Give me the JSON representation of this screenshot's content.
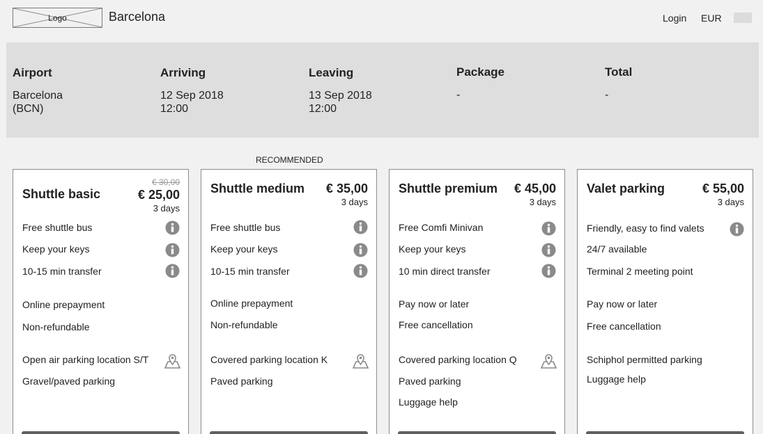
{
  "header": {
    "logo_text": "Logo",
    "city": "Barcelona",
    "login": "Login",
    "currency": "EUR"
  },
  "summary": {
    "airport_label": "Airport",
    "airport_value": "Barcelona\n(BCN)",
    "arriving_label": "Arriving",
    "arriving_value": "12 Sep 2018\n12:00",
    "leaving_label": "Leaving",
    "leaving_value": "13 Sep 2018\n12:00",
    "package_label": "Package",
    "package_value": "-",
    "total_label": "Total",
    "total_value": "-"
  },
  "recommended_label": "RECOMMENDED",
  "cards": [
    {
      "title": "Shuttle basic",
      "old_price": "€ 30,00",
      "price": "€ 25,00",
      "days": "3 days",
      "features": [
        "Free shuttle bus",
        "Keep your keys",
        "10-15 min transfer"
      ],
      "payment": [
        "Online prepayment",
        "Non-refundable"
      ],
      "parking": [
        "Open air parking location S/T",
        "Gravel/paved parking"
      ]
    },
    {
      "title": "Shuttle medium",
      "price": "€ 35,00",
      "days": "3 days",
      "features": [
        "Free shuttle bus",
        "Keep your keys",
        "10-15 min transfer"
      ],
      "payment": [
        "Online prepayment",
        "Non-refundable"
      ],
      "parking": [
        "Covered parking location K",
        "Paved parking"
      ]
    },
    {
      "title": "Shuttle premium",
      "price": "€ 45,00",
      "days": "3 days",
      "features": [
        "Free Comfi Minivan",
        "Keep your keys",
        "10 min direct transfer"
      ],
      "payment": [
        "Pay now or later",
        "Free cancellation"
      ],
      "parking": [
        "Covered parking location Q",
        "Paved parking",
        "Luggage help"
      ]
    },
    {
      "title": "Valet parking",
      "price": "€ 55,00",
      "days": "3 days",
      "features": [
        "Friendly, easy to find valets",
        "24/7 available",
        "Terminal 2 meeting point"
      ],
      "payment": [
        "Pay now or later",
        "Free cancellation"
      ],
      "parking": [
        "Schiphol permitted parking",
        "Luggage help"
      ]
    }
  ],
  "icons": {
    "info": "info-icon",
    "map": "map-pin-icon"
  },
  "colors": {
    "background": "#f1f1f1",
    "summary_bg": "#dedede",
    "icon_gray": "#8a8a8a",
    "button": "#5f5f5f"
  }
}
